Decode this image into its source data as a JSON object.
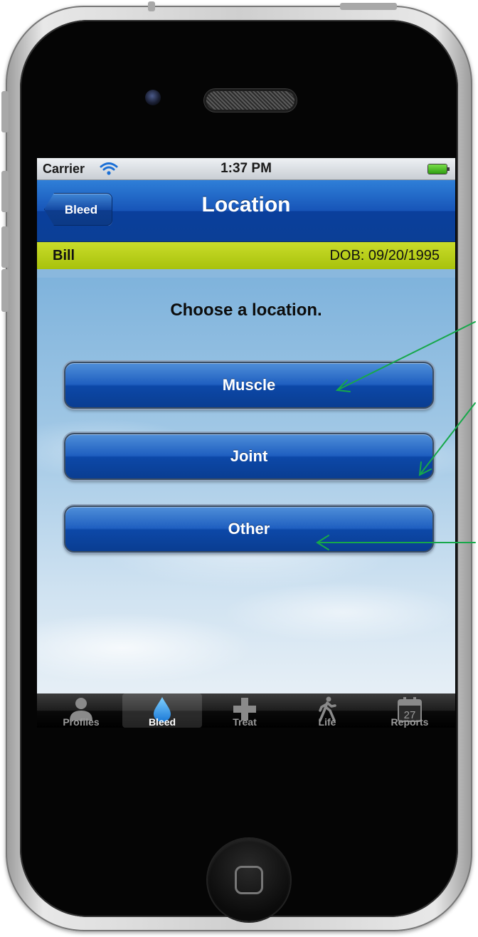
{
  "status_bar": {
    "carrier": "Carrier",
    "time": "1:37 PM"
  },
  "nav": {
    "back_label": "Bleed",
    "title": "Location"
  },
  "patient": {
    "name": "Bill",
    "dob": "DOB: 09/20/1995"
  },
  "main": {
    "prompt": "Choose a location.",
    "options": [
      "Muscle",
      "Joint",
      "Other"
    ]
  },
  "tabs": [
    {
      "label": "Profiles",
      "icon": "person-icon",
      "active": false
    },
    {
      "label": "Bleed",
      "icon": "droplet-icon",
      "active": true
    },
    {
      "label": "Treat",
      "icon": "plus-icon",
      "active": false
    },
    {
      "label": "Life",
      "icon": "walking-person-icon",
      "active": false
    },
    {
      "label": "Reports",
      "icon": "calendar-icon",
      "active": false,
      "icon_text": "27"
    }
  ],
  "colors": {
    "nav_blue": "#1755b8",
    "info_green": "#a8c20c",
    "annotation_arrow": "#17a84a"
  }
}
